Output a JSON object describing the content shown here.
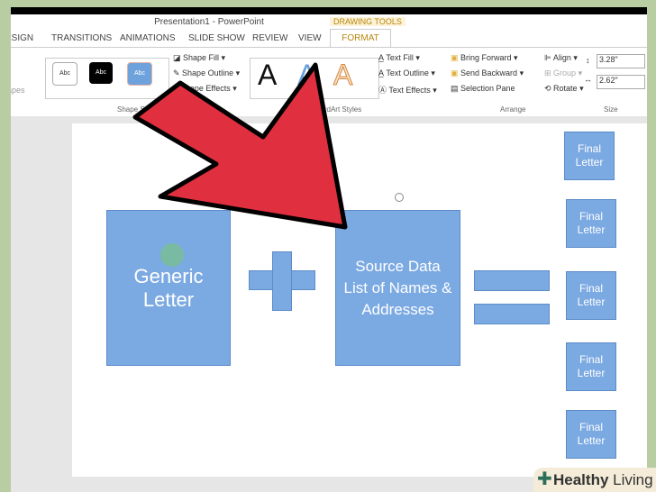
{
  "window": {
    "title": "Presentation1 - PowerPoint",
    "context_tab": "DRAWING TOOLS"
  },
  "tabs": [
    "ESIGN",
    "TRANSITIONS",
    "ANIMATIONS",
    "SLIDE SHOW",
    "REVIEW",
    "VIEW",
    "FORMAT"
  ],
  "ribbon": {
    "shapes_partial": "apes",
    "shape_styles": {
      "samples": [
        "Abc",
        "Abc",
        "Abc"
      ],
      "fill": "Shape Fill",
      "outline": "Shape Outline",
      "effects": "Shape Effects",
      "label": "Shape Styles"
    },
    "wordart": {
      "samples": [
        "A",
        "A",
        "A"
      ],
      "fill": "Text Fill",
      "outline": "Text Outline",
      "effects": "Text Effects",
      "label": "WordArt Styles"
    },
    "arrange": {
      "bring_forward": "Bring Forward",
      "send_backward": "Send Backward",
      "selection_pane": "Selection Pane",
      "align": "Align",
      "group": "Group",
      "rotate": "Rotate",
      "label": "Arrange"
    },
    "size": {
      "height": "3.28\"",
      "width": "2.62\"",
      "label": "Size"
    }
  },
  "slide": {
    "generic": "Generic Letter",
    "source": "Source Data List of Names & Addresses",
    "finals": [
      "Final Letter",
      "Final Letter",
      "Final Letter",
      "Final Letter",
      "Final Letter"
    ]
  },
  "watermark": {
    "brand": "Healthy",
    "suffix": "Living"
  }
}
